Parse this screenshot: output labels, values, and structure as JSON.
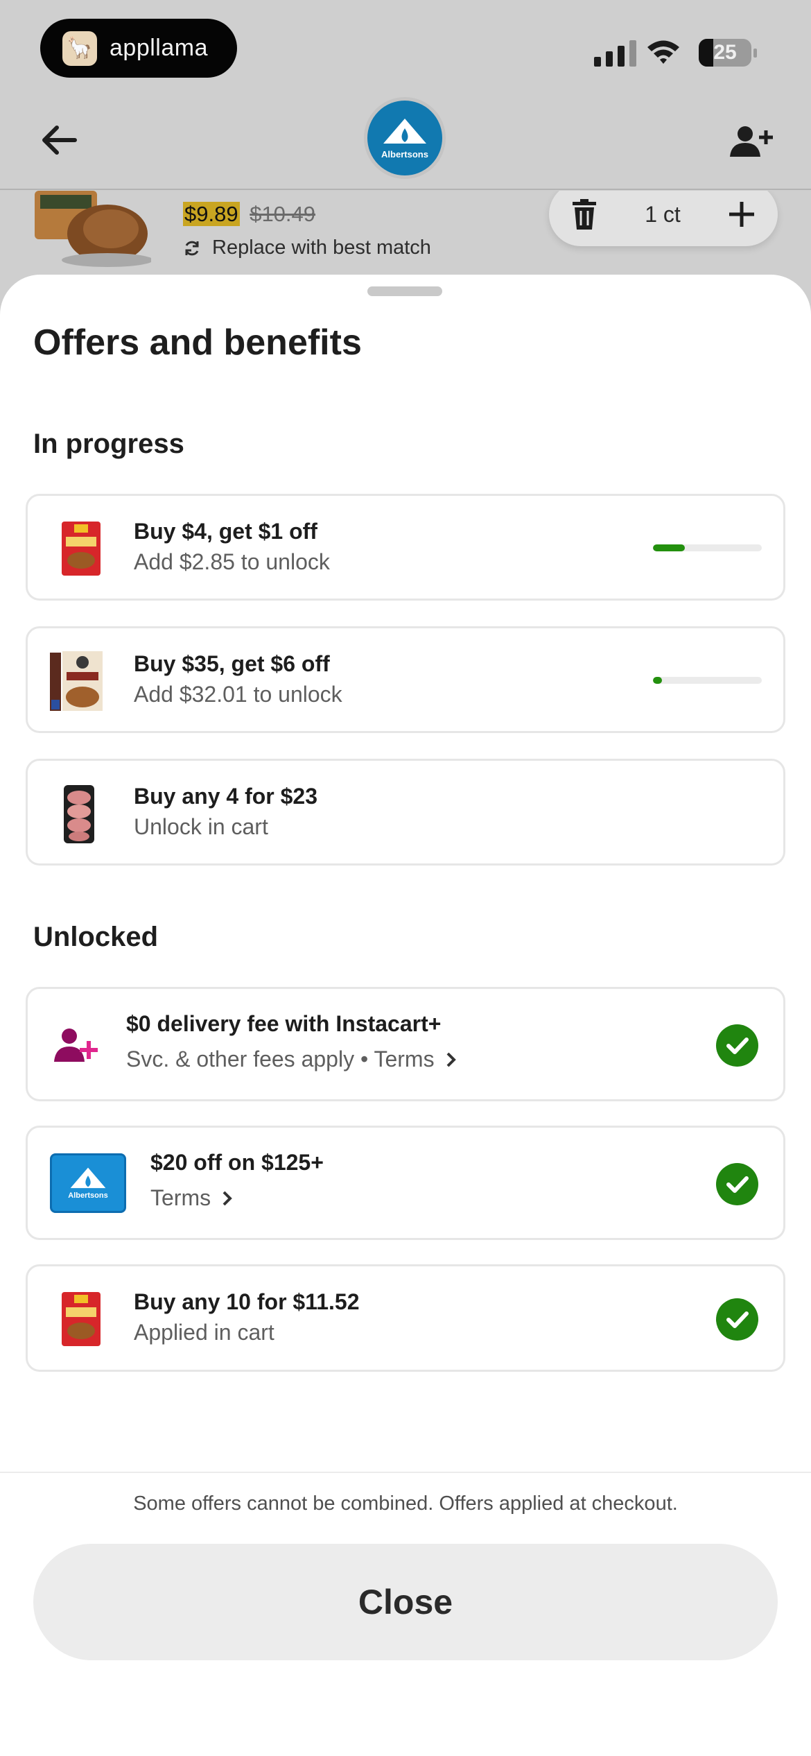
{
  "status_bar": {
    "app_name": "appllama",
    "battery": "25"
  },
  "header": {
    "store_name": "Albertsons"
  },
  "background_item": {
    "sale_price": "$9.89",
    "original_price": "$10.49",
    "replace_label": "Replace with best match",
    "quantity": "1 ct"
  },
  "sheet": {
    "title": "Offers and benefits",
    "in_progress_heading": "In progress",
    "unlocked_heading": "Unlocked",
    "in_progress": [
      {
        "title": "Buy $4, get $1 off",
        "subtitle": "Add $2.85 to unlock",
        "progress": 0.29,
        "icon": "seasoning-packet"
      },
      {
        "title": "Buy $35, get $6 off",
        "subtitle": "Add $32.01 to unlock",
        "progress": 0.08,
        "icon": "oatmeal-box"
      },
      {
        "title": "Buy any 4 for $23",
        "subtitle": "Unlock in cart",
        "icon": "meat-package"
      }
    ],
    "unlocked": [
      {
        "title": "$0 delivery fee with Instacart+",
        "subtitle": "Svc. & other fees apply • Terms",
        "icon": "instacart-plus-icon"
      },
      {
        "title": "$20 off on $125+",
        "subtitle": "Terms",
        "icon": "albertsons-logo"
      },
      {
        "title": "Buy any 10 for $11.52",
        "subtitle": "Applied in cart",
        "icon": "seasoning-packet"
      }
    ],
    "footer_note": "Some offers cannot be combined. Offers applied at checkout.",
    "close_label": "Close"
  },
  "colors": {
    "success_green": "#20850f",
    "progress_green": "#23900e",
    "brand_blue": "#1a8fd6",
    "instacart_magenta": "#c4138a"
  }
}
